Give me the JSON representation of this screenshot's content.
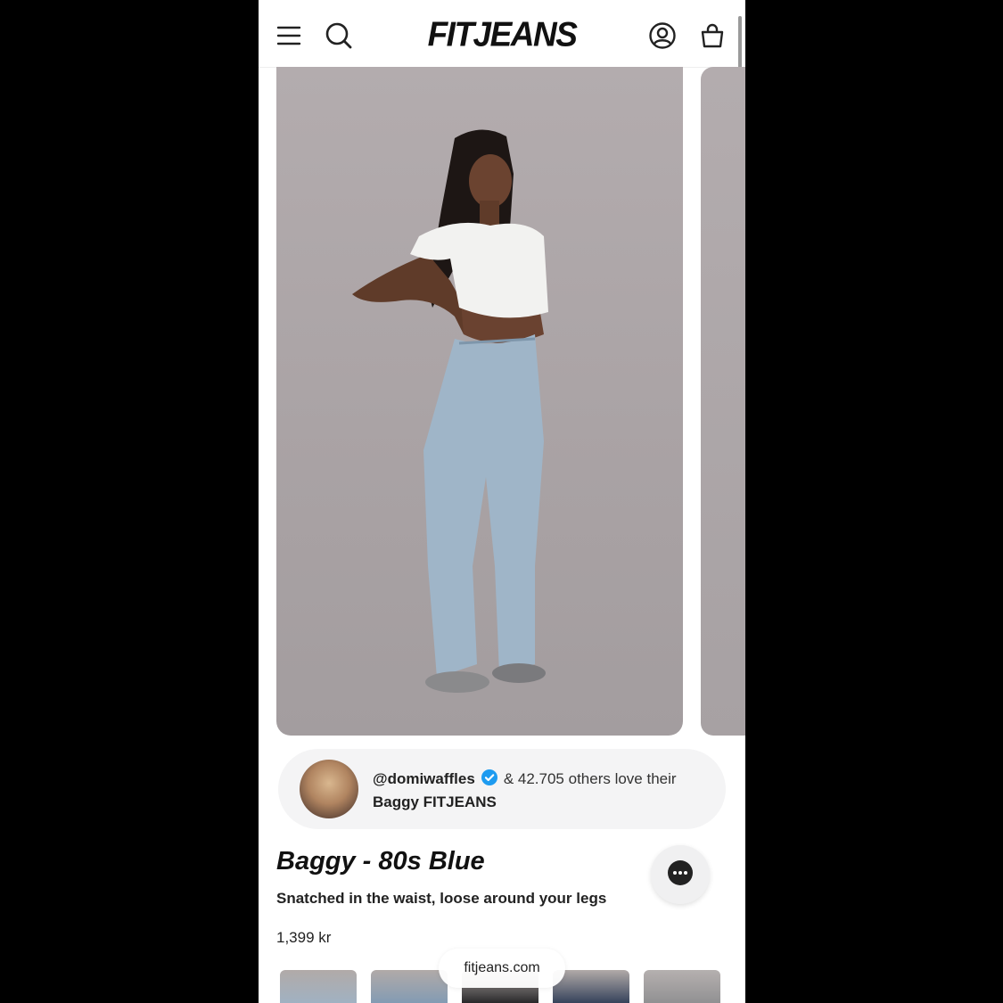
{
  "header": {
    "brand": "FITJEANS",
    "icons": [
      "menu-icon",
      "search-icon",
      "account-icon",
      "cart-icon"
    ]
  },
  "hero": {
    "image": "model wearing light-wash baggy jeans and white crop top",
    "next_image": "next carousel image"
  },
  "social_proof": {
    "handle": "@domiwaffles",
    "text_line1": "& 42.705 others love their",
    "text_line2": "Baggy FITJEANS"
  },
  "product": {
    "title": "Baggy - 80s Blue",
    "subtitle": "Snatched in the waist, loose around your legs",
    "price": "1,399 kr"
  },
  "browser": {
    "url": "fitjeans.com"
  },
  "colors": {
    "background": "#000000",
    "page": "#ffffff",
    "verified": "#1d9bf0"
  }
}
